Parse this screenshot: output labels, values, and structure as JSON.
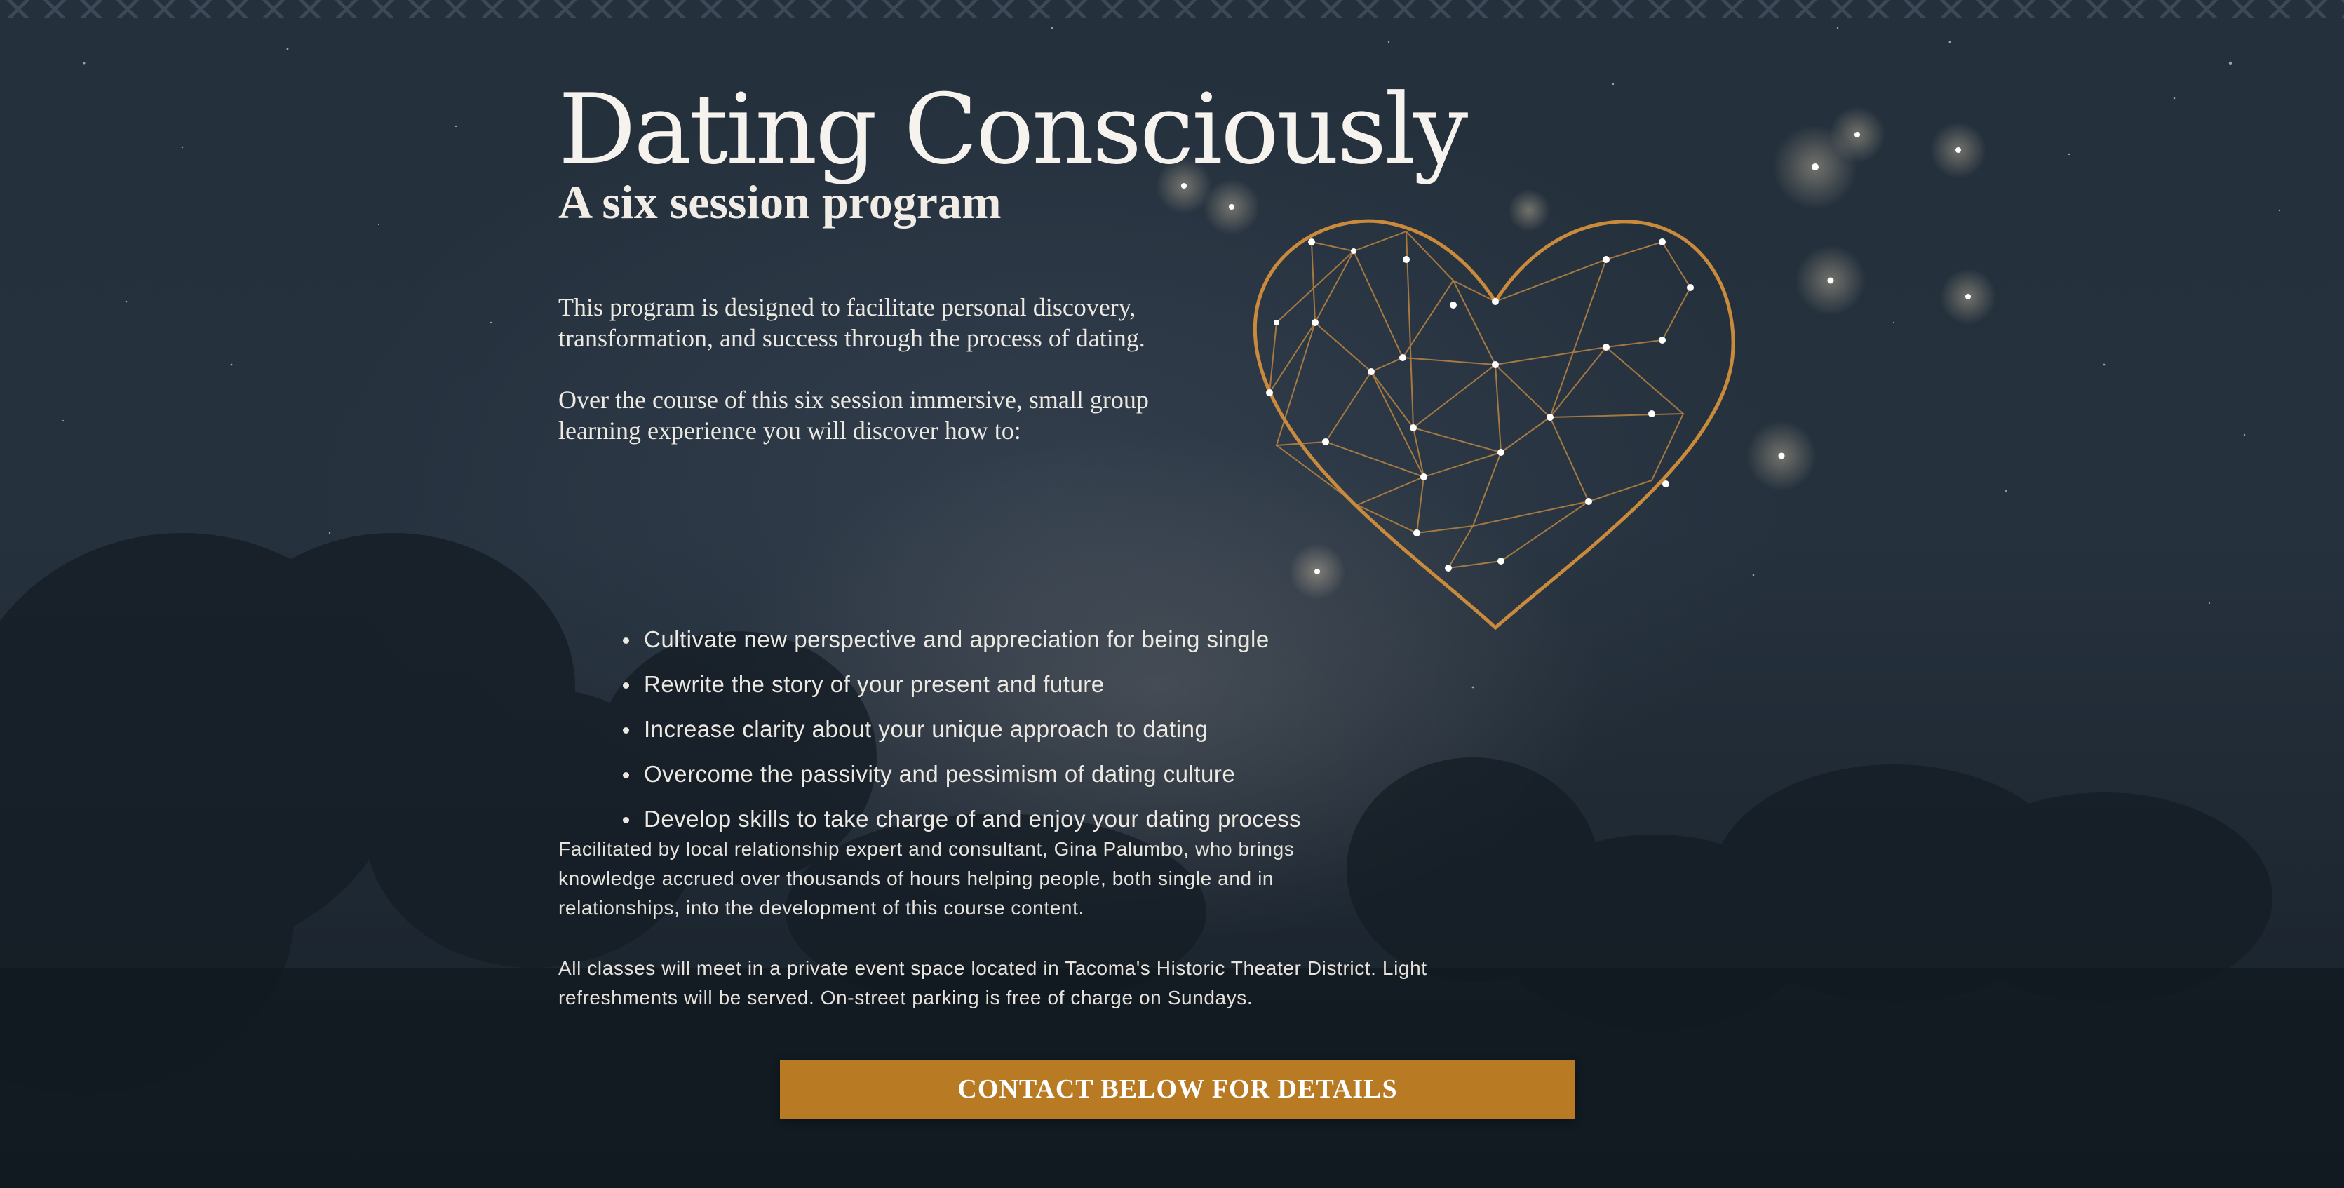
{
  "page": {
    "title": "Dating Consciously",
    "subtitle": "A six session program",
    "intro": [
      "This program is designed to facilitate personal discovery, transformation, and success through the process of dating.",
      "Over the course of this six session immersive, small group learning experience you will discover how to:"
    ],
    "bullets": [
      "Cultivate new perspective and appreciation for being single",
      "Rewrite the story of your present and future",
      "Increase clarity about your unique approach to dating",
      "Overcome the passivity and pessimism of dating culture",
      "Develop skills to take charge of and enjoy your dating process"
    ],
    "facilitator_text": "Facilitated by local relationship expert and consultant, Gina Palumbo, who brings knowledge accrued over thousands of hours helping people, both single and in relationships, into the development of this course content.",
    "location_text": "All classes will meet in a private event space located in Tacoma's Historic Theater District. Light refreshments will be served. On-street parking is free of charge on Sundays.",
    "cta_label": "CONTACT BELOW FOR DETAILS"
  },
  "colors": {
    "accent": "#b87b24",
    "background": "#1f2a35",
    "text": "#f2efe9",
    "heart_line": "#c98a3c"
  },
  "icons": {
    "heart": "constellation-heart-icon"
  }
}
